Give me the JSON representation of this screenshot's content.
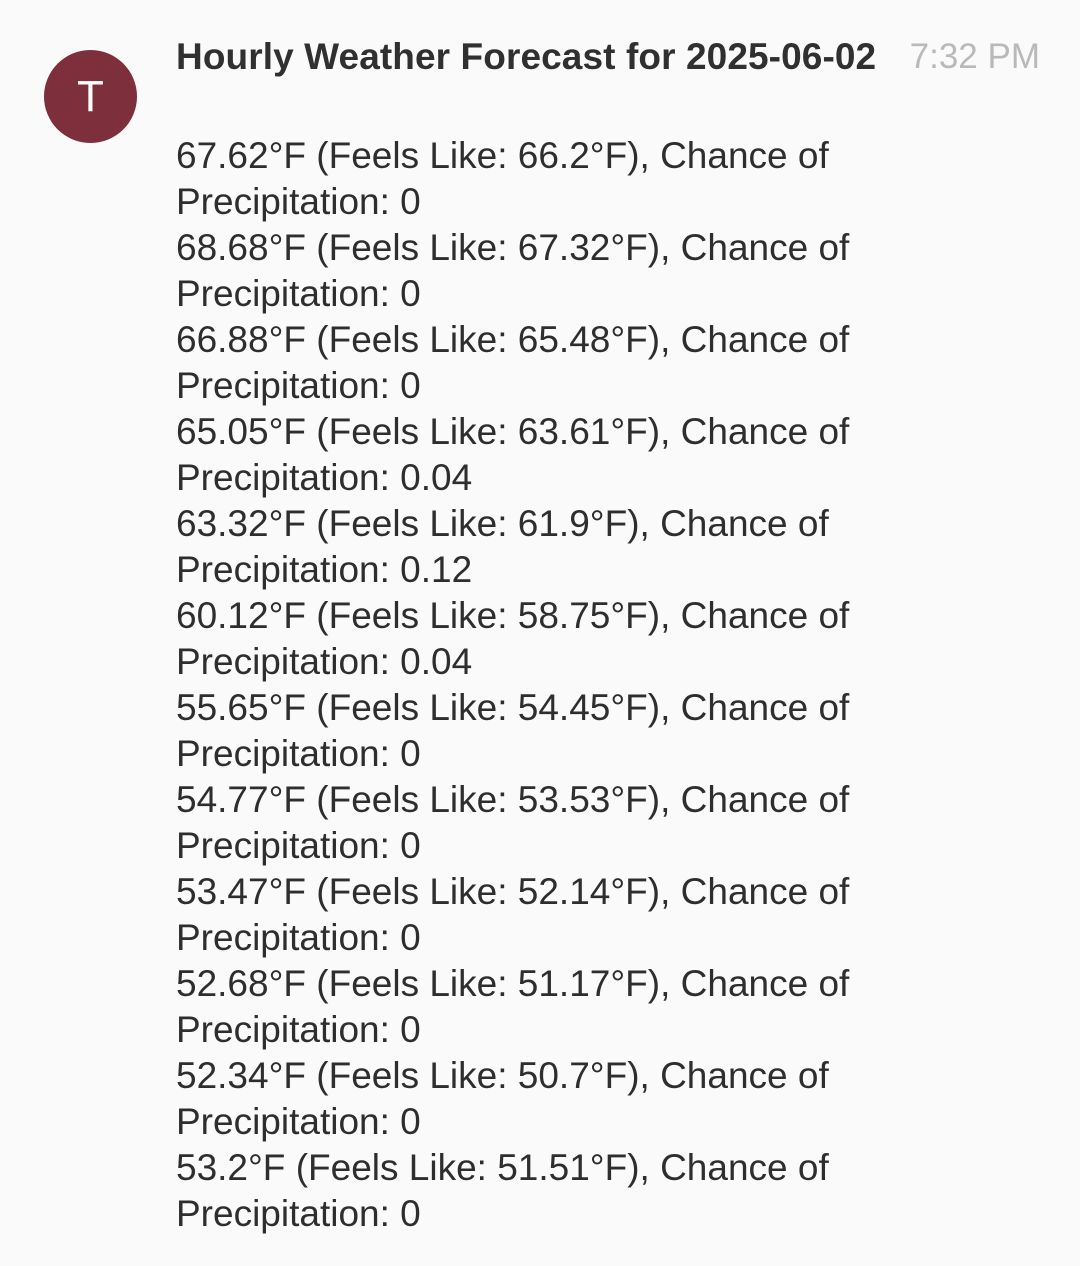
{
  "message": {
    "sender_initial": "T",
    "title": "Hourly Weather Forecast for 2025-06-02",
    "time": "7:32 PM",
    "lines": [
      "67.62°F (Feels Like: 66.2°F), Chance of",
      "Precipitation: 0",
      "68.68°F (Feels Like: 67.32°F), Chance of",
      "Precipitation: 0",
      "66.88°F (Feels Like: 65.48°F), Chance of",
      "Precipitation: 0",
      "65.05°F (Feels Like: 63.61°F), Chance of",
      "Precipitation: 0.04",
      "63.32°F (Feels Like: 61.9°F), Chance of",
      "Precipitation: 0.12",
      "60.12°F (Feels Like: 58.75°F), Chance of",
      "Precipitation: 0.04",
      "55.65°F (Feels Like: 54.45°F), Chance of",
      "Precipitation: 0",
      "54.77°F (Feels Like: 53.53°F), Chance of",
      "Precipitation: 0",
      "53.47°F (Feels Like: 52.14°F), Chance of",
      "Precipitation: 0",
      "52.68°F (Feels Like: 51.17°F), Chance of",
      "Precipitation: 0",
      "52.34°F (Feels Like: 50.7°F), Chance of",
      "Precipitation: 0",
      "53.2°F (Feels Like: 51.51°F), Chance of",
      "Precipitation: 0"
    ]
  },
  "colors": {
    "avatar_background": "#7d2f3b",
    "background": "#fafafa",
    "timestamp": "#b9b9b9"
  }
}
